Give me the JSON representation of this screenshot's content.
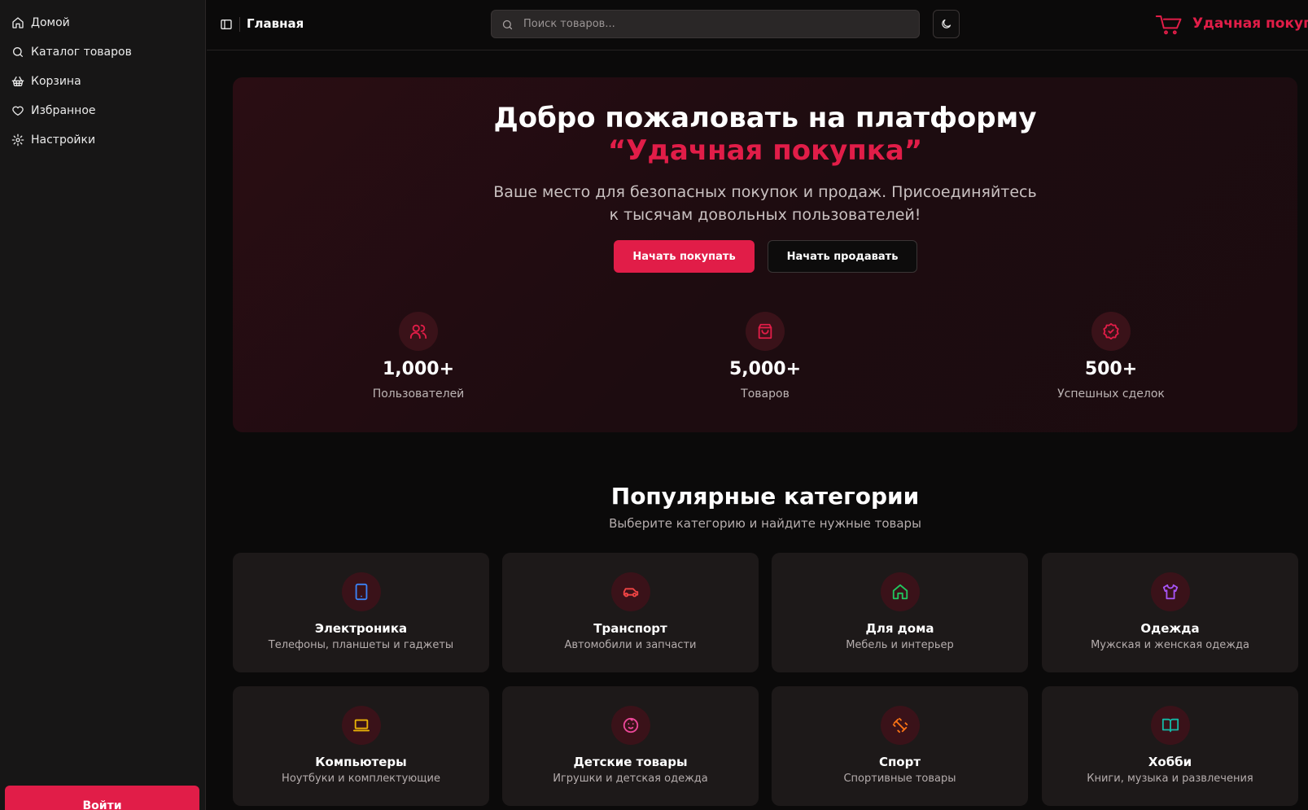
{
  "sidebar": {
    "items": [
      {
        "label": "Домой",
        "icon": "home-icon"
      },
      {
        "label": "Каталог товаров",
        "icon": "search-icon"
      },
      {
        "label": "Корзина",
        "icon": "basket-icon"
      },
      {
        "label": "Избранное",
        "icon": "heart-icon"
      },
      {
        "label": "Настройки",
        "icon": "gear-icon"
      }
    ],
    "login_label": "Войти"
  },
  "header": {
    "title": "Главная",
    "search_placeholder": "Поиск товаров...",
    "brand_name": "Удачная покупка"
  },
  "hero": {
    "title": "Добро пожаловать на платформу",
    "accent": "“Удачная покупка”",
    "subtitle": "Ваше место для безопасных покупок и продаж. Присоединяйтесь к тысячам довольных пользователей!",
    "primary_button": "Начать покупать",
    "secondary_button": "Начать продавать",
    "stats": [
      {
        "value": "1,000+",
        "label": "Пользователей",
        "icon": "users-icon"
      },
      {
        "value": "5,000+",
        "label": "Товаров",
        "icon": "shopping-bag-icon"
      },
      {
        "value": "500+",
        "label": "Успешных сделок",
        "icon": "badge-check-icon"
      }
    ]
  },
  "categories": {
    "title": "Популярные категории",
    "subtitle": "Выберите категорию и найдите нужные товары",
    "items": [
      {
        "name": "Электроника",
        "desc": "Телефоны, планшеты и гаджеты",
        "icon": "tablet-icon",
        "color": "#3b82f6"
      },
      {
        "name": "Транспорт",
        "desc": "Автомобили и запчасти",
        "icon": "car-icon",
        "color": "#ef4444"
      },
      {
        "name": "Для дома",
        "desc": "Мебель и интерьер",
        "icon": "house-icon",
        "color": "#22c55e"
      },
      {
        "name": "Одежда",
        "desc": "Мужская и женская одежда",
        "icon": "shirt-icon",
        "color": "#a855f7"
      },
      {
        "name": "Компьютеры",
        "desc": "Ноутбуки и комплектующие",
        "icon": "laptop-icon",
        "color": "#eab308"
      },
      {
        "name": "Детские товары",
        "desc": "Игрушки и детская одежда",
        "icon": "baby-icon",
        "color": "#ec4899"
      },
      {
        "name": "Спорт",
        "desc": "Спортивные товары",
        "icon": "dumbbell-icon",
        "color": "#f97316"
      },
      {
        "name": "Хобби",
        "desc": "Книги, музыка и развлечения",
        "icon": "book-icon",
        "color": "#14b8a6"
      }
    ]
  },
  "colors": {
    "accent": "#e11d48",
    "background": "#0b0a0a",
    "sidebar": "#171616",
    "card": "#1d1919"
  }
}
